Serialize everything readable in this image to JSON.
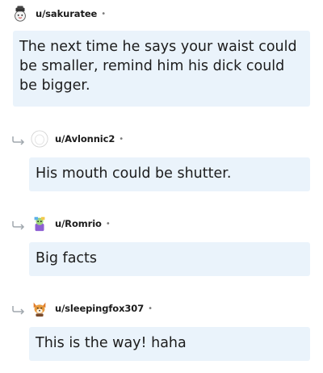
{
  "comments": [
    {
      "username": "u/sakuratee",
      "dot": "•",
      "text": "The next time he says your waist could be smaller, remind him his dick could be bigger.",
      "avatar": "sakuratee-avatar-icon"
    },
    {
      "username": "u/Avlonnic2",
      "dot": "•",
      "text": "His mouth could be shutter.",
      "avatar": "blank-avatar-icon"
    },
    {
      "username": "u/Romrio",
      "dot": "•",
      "text": "Big facts",
      "avatar": "romrio-avatar-icon"
    },
    {
      "username": "u/sleepingfox307",
      "dot": "•",
      "text": "This is the way! haha",
      "avatar": "fox-avatar-icon"
    }
  ],
  "colors": {
    "bubble": "#eaf3fb",
    "username": "#1c1c1c",
    "reply_arrow": "#a0a7ad"
  }
}
